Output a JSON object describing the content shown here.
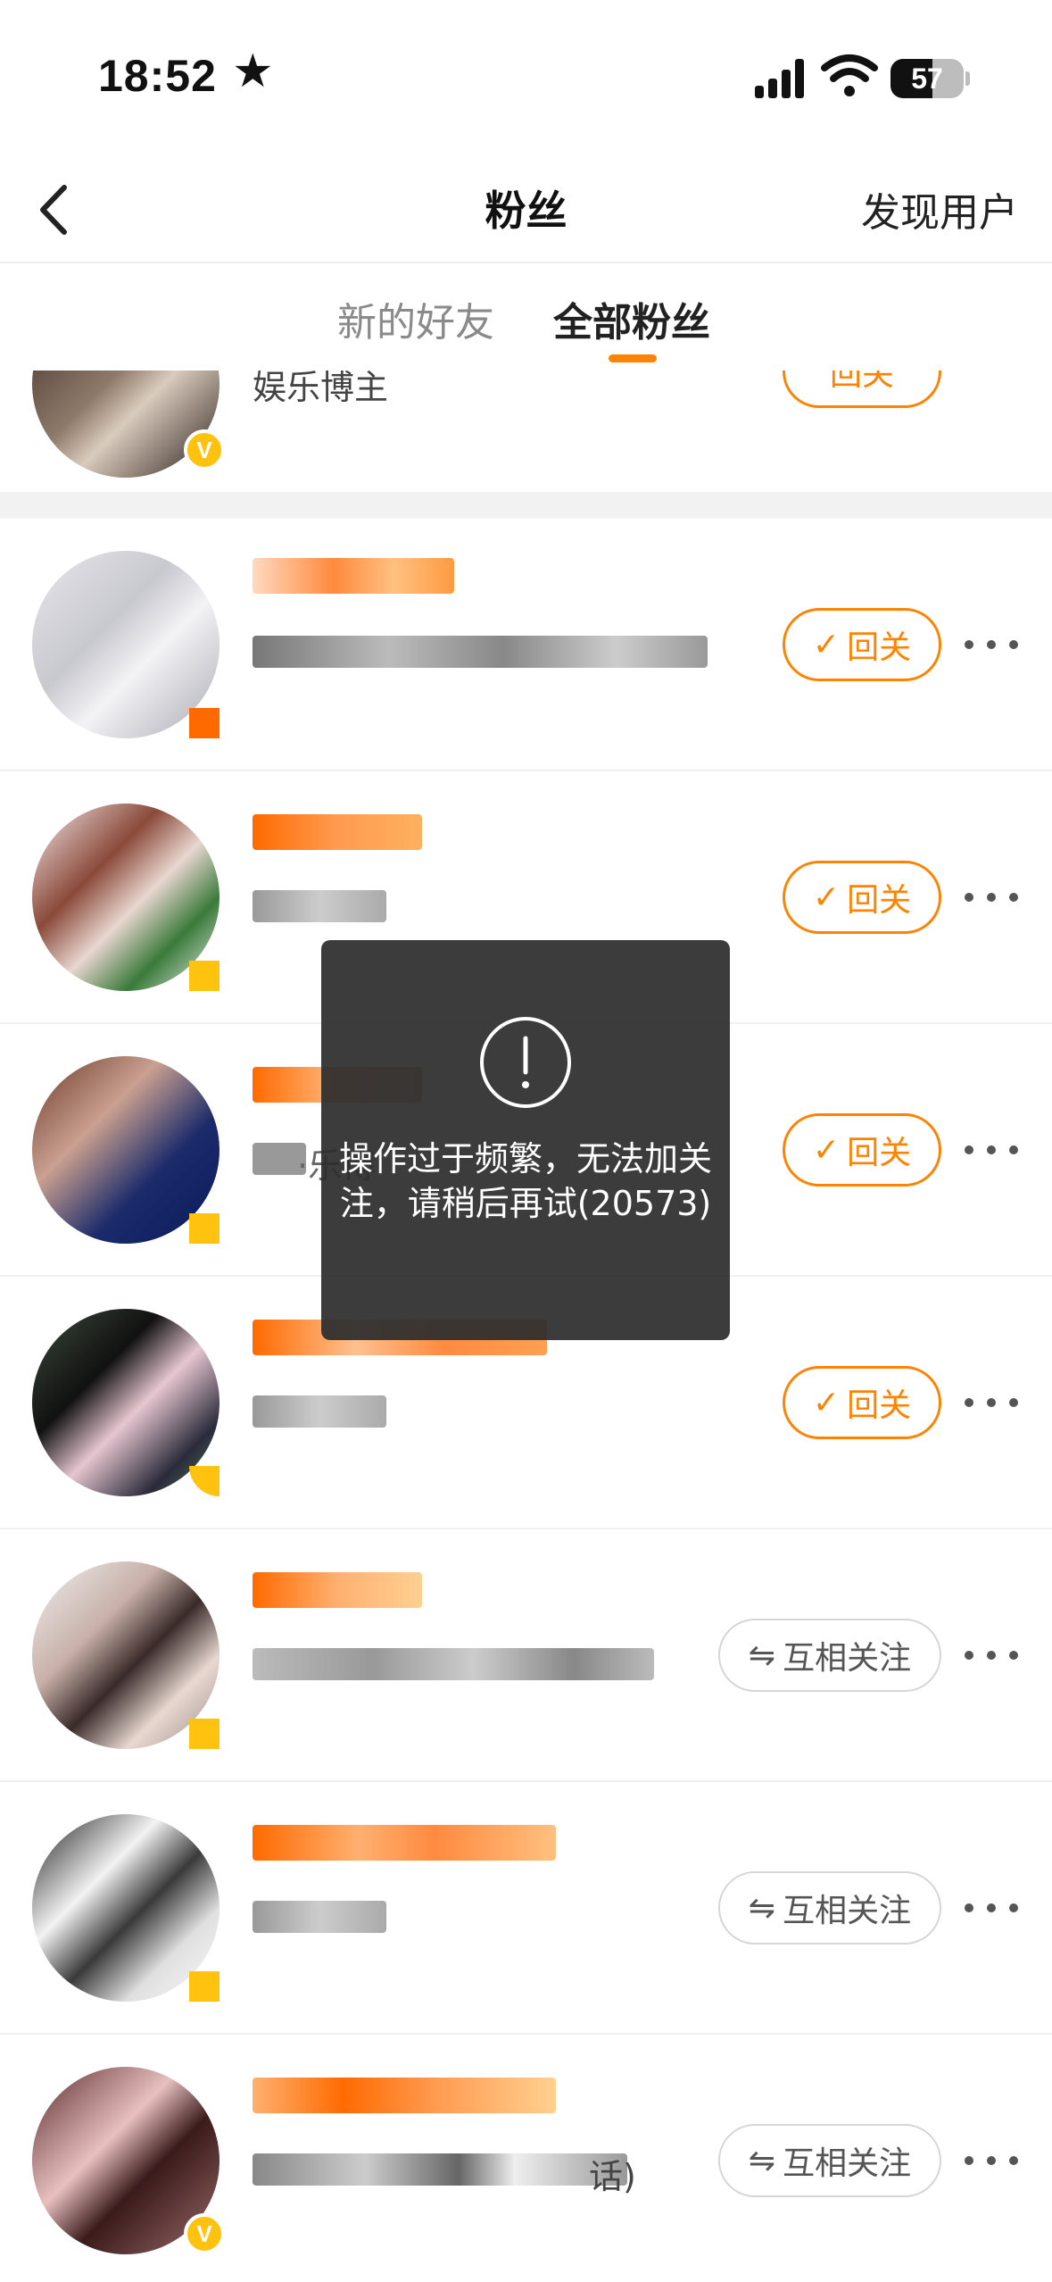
{
  "status_bar": {
    "time": "18:52",
    "battery": "57",
    "battery_level": 0.57
  },
  "nav": {
    "title": "粉丝",
    "right_action": "发现用户"
  },
  "tabs": [
    {
      "label": "新的好友",
      "active": false
    },
    {
      "label": "全部粉丝",
      "active": true
    }
  ],
  "partial_item": {
    "desc": "娱乐博主",
    "button": "回关"
  },
  "items": [
    {
      "button": "回关",
      "button_type": "follow-back"
    },
    {
      "button": "回关",
      "button_type": "follow-back"
    },
    {
      "button": "回关",
      "button_type": "follow-back",
      "desc_fragment": "·乐博"
    },
    {
      "button": "回关",
      "button_type": "follow-back"
    },
    {
      "button": "互相关注",
      "button_type": "mutual"
    },
    {
      "button": "互相关注",
      "button_type": "mutual"
    },
    {
      "button": "互相关注",
      "button_type": "mutual",
      "desc_fragment": "话)"
    }
  ],
  "toast": {
    "message": "操作过于频繁，无法加关注，请稍后再试(20573)"
  },
  "colors": {
    "accent": "#ff8200",
    "verify": "#ffc20e",
    "toast_bg": "#2d2d2d"
  }
}
